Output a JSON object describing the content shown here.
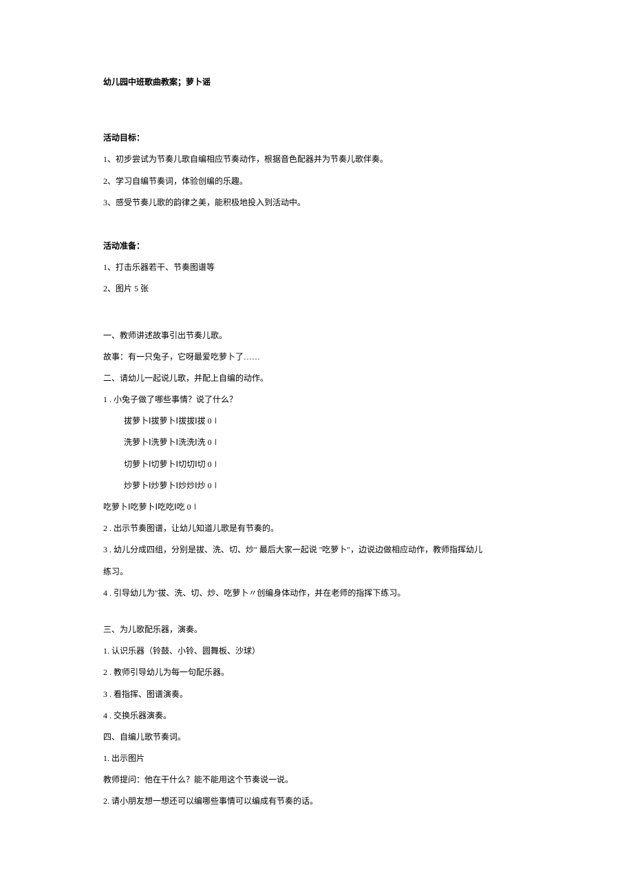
{
  "title": "幼儿园中班歌曲教案；萝卜谣",
  "sections": {
    "goals": {
      "heading": "活动目标：",
      "items": [
        "1、初步尝试为节奏儿歌自编相应节奏动作，根据音色配器并为节奏儿歌伴奏。",
        "2、学习自编节奏词，体验创编的乐趣。",
        "3、感受节奏儿歌的韵律之美，能积极地投入到活动中。"
      ]
    },
    "prep": {
      "heading": "活动准备：",
      "items": [
        "1、打击乐器若干、节奏图谱等",
        "2、图片 5 张"
      ]
    },
    "part1": {
      "line1": "一、教师讲述故事引出节奏儿歌。",
      "line2": "故事：有一只兔子，它呀最爱吃萝卜了……",
      "line3": "二、请幼儿一起说儿歌，并配上自编的动作。",
      "q1": "1 . 小兔子做了哪些事情？说了什么？",
      "rhyme": [
        "拔萝卜Ⅰ拔萝卜Ⅰ拔拔Ⅰ拔 0∣",
        "洗萝卜Ⅰ洗萝卜Ⅰ洗洗Ⅰ洗 0∣",
        "切萝卜Ⅰ切萝卜Ⅰ切切Ⅰ切 0∣",
        "炒萝卜Ⅰ炒萝卜Ⅰ炒炒Ⅰ炒 0∣"
      ],
      "rhyme_last": "吃萝卜Ⅰ吃萝卜Ⅰ吃吃Ⅰ吃 0∣",
      "q2": "2 . 出示节奏图谱，让幼儿知道儿歌是有节奏的。",
      "q3a": "3 . 幼儿分成四组，分别是拔、洗、切、炒\" 最后大家一起说 ''吃萝卜\"，边说边做相应动作，教师指挥幼儿",
      "q3b": "练习。",
      "q4": "4 . 引导幼儿为''拔、洗、切、炒、吃萝卜〃创编身体动作，并在老师的指挥下练习。"
    },
    "part3": {
      "heading": "三、为儿歌配乐器，演奏。",
      "items": [
        "1. 认识乐器（铃鼓、小铃、圆舞板、沙球）",
        "2 . 教师引导幼儿为每一句配乐器。",
        "3 . 看指挥、图谱演奏。",
        "4 . 交换乐器演奏。"
      ]
    },
    "part4": {
      "heading": "四、自编儿歌节奏词。",
      "items": [
        "1. 出示图片",
        "教师提问：他在干什么？能不能用这个节奏说一说。",
        "2. 请小朋友想一想还可以编哪些事情可以编成有节奏的话。"
      ]
    }
  }
}
